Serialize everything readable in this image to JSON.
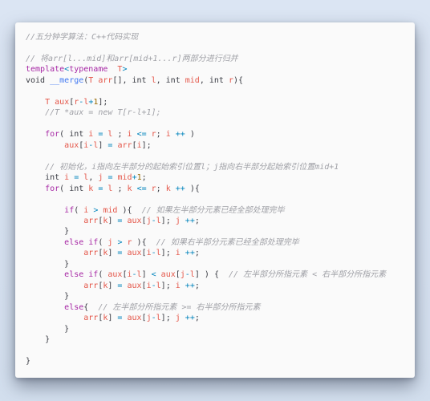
{
  "colors": {
    "background": "#d9e3f2",
    "card": "#fafafa",
    "comment": "#a0a1a7",
    "keyword": "#a626a4",
    "variable": "#e45649",
    "operator": "#0184bc",
    "number": "#986801",
    "function": "#4078f2",
    "plain": "#383a42"
  },
  "code_lines": [
    [
      [
        "c",
        "//五分钟学算法：C++代码实现"
      ]
    ],
    [],
    [
      [
        "c",
        "// 将arr[l...mid]和arr[mid+1...r]两部分进行归并"
      ]
    ],
    [
      [
        "k",
        "template"
      ],
      [
        "o",
        "<"
      ],
      [
        "k",
        "typename"
      ],
      [
        "p",
        "  "
      ],
      [
        "v",
        "T"
      ],
      [
        "o",
        ">"
      ]
    ],
    [
      [
        "p",
        "void "
      ],
      [
        "f",
        "__merge"
      ],
      [
        "p",
        "("
      ],
      [
        "v",
        "T"
      ],
      [
        "p",
        " "
      ],
      [
        "v",
        "arr"
      ],
      [
        "p",
        "[], int "
      ],
      [
        "v",
        "l"
      ],
      [
        "p",
        ", int "
      ],
      [
        "v",
        "mid"
      ],
      [
        "p",
        ", int "
      ],
      [
        "v",
        "r"
      ],
      [
        "p",
        "){"
      ]
    ],
    [],
    [
      [
        "p",
        "    "
      ],
      [
        "v",
        "T"
      ],
      [
        "p",
        " "
      ],
      [
        "v",
        "aux"
      ],
      [
        "p",
        "["
      ],
      [
        "v",
        "r"
      ],
      [
        "o",
        "-"
      ],
      [
        "v",
        "l"
      ],
      [
        "o",
        "+"
      ],
      [
        "n",
        "1"
      ],
      [
        "p",
        "];"
      ]
    ],
    [
      [
        "p",
        "    "
      ],
      [
        "c",
        "//T *aux = new T[r-l+1];"
      ]
    ],
    [],
    [
      [
        "p",
        "    "
      ],
      [
        "k",
        "for"
      ],
      [
        "p",
        "( int "
      ],
      [
        "v",
        "i"
      ],
      [
        "p",
        " "
      ],
      [
        "o",
        "="
      ],
      [
        "p",
        " "
      ],
      [
        "v",
        "l"
      ],
      [
        "p",
        " ; "
      ],
      [
        "v",
        "i"
      ],
      [
        "p",
        " "
      ],
      [
        "o",
        "<="
      ],
      [
        "p",
        " "
      ],
      [
        "v",
        "r"
      ],
      [
        "p",
        "; "
      ],
      [
        "v",
        "i"
      ],
      [
        "p",
        " "
      ],
      [
        "o",
        "++"
      ],
      [
        "p",
        " )"
      ]
    ],
    [
      [
        "p",
        "        "
      ],
      [
        "v",
        "aux"
      ],
      [
        "p",
        "["
      ],
      [
        "v",
        "i"
      ],
      [
        "o",
        "-"
      ],
      [
        "v",
        "l"
      ],
      [
        "p",
        "] "
      ],
      [
        "o",
        "="
      ],
      [
        "p",
        " "
      ],
      [
        "v",
        "arr"
      ],
      [
        "p",
        "["
      ],
      [
        "v",
        "i"
      ],
      [
        "p",
        "];"
      ]
    ],
    [],
    [
      [
        "p",
        "    "
      ],
      [
        "c",
        "// 初始化，i指向左半部分的起始索引位置l；j指向右半部分起始索引位置mid+1"
      ]
    ],
    [
      [
        "p",
        "    int "
      ],
      [
        "v",
        "i"
      ],
      [
        "p",
        " "
      ],
      [
        "o",
        "="
      ],
      [
        "p",
        " "
      ],
      [
        "v",
        "l"
      ],
      [
        "p",
        ", "
      ],
      [
        "v",
        "j"
      ],
      [
        "p",
        " "
      ],
      [
        "o",
        "="
      ],
      [
        "p",
        " "
      ],
      [
        "v",
        "mid"
      ],
      [
        "o",
        "+"
      ],
      [
        "n",
        "1"
      ],
      [
        "p",
        ";"
      ]
    ],
    [
      [
        "p",
        "    "
      ],
      [
        "k",
        "for"
      ],
      [
        "p",
        "( int "
      ],
      [
        "v",
        "k"
      ],
      [
        "p",
        " "
      ],
      [
        "o",
        "="
      ],
      [
        "p",
        " "
      ],
      [
        "v",
        "l"
      ],
      [
        "p",
        " ; "
      ],
      [
        "v",
        "k"
      ],
      [
        "p",
        " "
      ],
      [
        "o",
        "<="
      ],
      [
        "p",
        " "
      ],
      [
        "v",
        "r"
      ],
      [
        "p",
        "; "
      ],
      [
        "v",
        "k"
      ],
      [
        "p",
        " "
      ],
      [
        "o",
        "++"
      ],
      [
        "p",
        " ){"
      ]
    ],
    [],
    [
      [
        "p",
        "        "
      ],
      [
        "k",
        "if"
      ],
      [
        "p",
        "( "
      ],
      [
        "v",
        "i"
      ],
      [
        "p",
        " "
      ],
      [
        "o",
        ">"
      ],
      [
        "p",
        " "
      ],
      [
        "v",
        "mid"
      ],
      [
        "p",
        " ){  "
      ],
      [
        "c",
        "// 如果左半部分元素已经全部处理完毕"
      ]
    ],
    [
      [
        "p",
        "            "
      ],
      [
        "v",
        "arr"
      ],
      [
        "p",
        "["
      ],
      [
        "v",
        "k"
      ],
      [
        "p",
        "] "
      ],
      [
        "o",
        "="
      ],
      [
        "p",
        " "
      ],
      [
        "v",
        "aux"
      ],
      [
        "p",
        "["
      ],
      [
        "v",
        "j"
      ],
      [
        "o",
        "-"
      ],
      [
        "v",
        "l"
      ],
      [
        "p",
        "]; "
      ],
      [
        "v",
        "j"
      ],
      [
        "p",
        " "
      ],
      [
        "o",
        "++"
      ],
      [
        "p",
        ";"
      ]
    ],
    [
      [
        "p",
        "        }"
      ]
    ],
    [
      [
        "p",
        "        "
      ],
      [
        "k",
        "else if"
      ],
      [
        "p",
        "( "
      ],
      [
        "v",
        "j"
      ],
      [
        "p",
        " "
      ],
      [
        "o",
        ">"
      ],
      [
        "p",
        " "
      ],
      [
        "v",
        "r"
      ],
      [
        "p",
        " ){  "
      ],
      [
        "c",
        "// 如果右半部分元素已经全部处理完毕"
      ]
    ],
    [
      [
        "p",
        "            "
      ],
      [
        "v",
        "arr"
      ],
      [
        "p",
        "["
      ],
      [
        "v",
        "k"
      ],
      [
        "p",
        "] "
      ],
      [
        "o",
        "="
      ],
      [
        "p",
        " "
      ],
      [
        "v",
        "aux"
      ],
      [
        "p",
        "["
      ],
      [
        "v",
        "i"
      ],
      [
        "o",
        "-"
      ],
      [
        "v",
        "l"
      ],
      [
        "p",
        "]; "
      ],
      [
        "v",
        "i"
      ],
      [
        "p",
        " "
      ],
      [
        "o",
        "++"
      ],
      [
        "p",
        ";"
      ]
    ],
    [
      [
        "p",
        "        }"
      ]
    ],
    [
      [
        "p",
        "        "
      ],
      [
        "k",
        "else if"
      ],
      [
        "p",
        "( "
      ],
      [
        "v",
        "aux"
      ],
      [
        "p",
        "["
      ],
      [
        "v",
        "i"
      ],
      [
        "o",
        "-"
      ],
      [
        "v",
        "l"
      ],
      [
        "p",
        "] "
      ],
      [
        "o",
        "<"
      ],
      [
        "p",
        " "
      ],
      [
        "v",
        "aux"
      ],
      [
        "p",
        "["
      ],
      [
        "v",
        "j"
      ],
      [
        "o",
        "-"
      ],
      [
        "v",
        "l"
      ],
      [
        "p",
        "] ) {  "
      ],
      [
        "c",
        "// 左半部分所指元素 < 右半部分所指元素"
      ]
    ],
    [
      [
        "p",
        "            "
      ],
      [
        "v",
        "arr"
      ],
      [
        "p",
        "["
      ],
      [
        "v",
        "k"
      ],
      [
        "p",
        "] "
      ],
      [
        "o",
        "="
      ],
      [
        "p",
        " "
      ],
      [
        "v",
        "aux"
      ],
      [
        "p",
        "["
      ],
      [
        "v",
        "i"
      ],
      [
        "o",
        "-"
      ],
      [
        "v",
        "l"
      ],
      [
        "p",
        "]; "
      ],
      [
        "v",
        "i"
      ],
      [
        "p",
        " "
      ],
      [
        "o",
        "++"
      ],
      [
        "p",
        ";"
      ]
    ],
    [
      [
        "p",
        "        }"
      ]
    ],
    [
      [
        "p",
        "        "
      ],
      [
        "k",
        "else"
      ],
      [
        "p",
        "{  "
      ],
      [
        "c",
        "// 左半部分所指元素 >= 右半部分所指元素"
      ]
    ],
    [
      [
        "p",
        "            "
      ],
      [
        "v",
        "arr"
      ],
      [
        "p",
        "["
      ],
      [
        "v",
        "k"
      ],
      [
        "p",
        "] "
      ],
      [
        "o",
        "="
      ],
      [
        "p",
        " "
      ],
      [
        "v",
        "aux"
      ],
      [
        "p",
        "["
      ],
      [
        "v",
        "j"
      ],
      [
        "o",
        "-"
      ],
      [
        "v",
        "l"
      ],
      [
        "p",
        "]; "
      ],
      [
        "v",
        "j"
      ],
      [
        "p",
        " "
      ],
      [
        "o",
        "++"
      ],
      [
        "p",
        ";"
      ]
    ],
    [
      [
        "p",
        "        }"
      ]
    ],
    [
      [
        "p",
        "    }"
      ]
    ],
    [],
    [
      [
        "p",
        "}"
      ]
    ]
  ]
}
